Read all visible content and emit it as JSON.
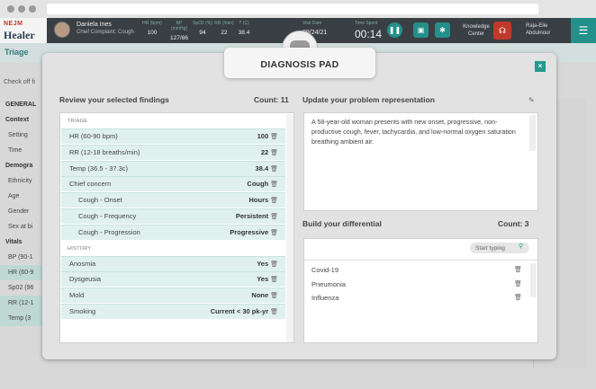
{
  "app": {
    "logo_top": "NEJM",
    "logo_bottom": "Healer",
    "patient_name": "Daniela Ines",
    "chief_complaint": "Chief Complaint: Cough",
    "vitals": [
      {
        "label": "HR (bpm)",
        "value": "100"
      },
      {
        "label": "BP (mmHg)",
        "value": "127/86"
      },
      {
        "label": "SpO2 (%)",
        "value": "94"
      },
      {
        "label": "RR (/min)",
        "value": "22"
      },
      {
        "label": "T (C)",
        "value": "38.4"
      }
    ],
    "visit_label": "Visit Date",
    "visit_date": "09/24/21",
    "time_label": "Time Spent",
    "time_value": "00:14",
    "knowledge_center": "Knowledge Center",
    "user_name": "Raja-Elie Abdulnour"
  },
  "background": {
    "triage_title": "Triage",
    "check_off": "Check off fi",
    "list": [
      {
        "text": "GENERAL",
        "kind": "h"
      },
      {
        "text": "Context",
        "kind": "h"
      },
      {
        "text": "Setting",
        "kind": "i"
      },
      {
        "text": "Time",
        "kind": "i"
      },
      {
        "text": "Demogra",
        "kind": "h"
      },
      {
        "text": "Ethnicity",
        "kind": "i"
      },
      {
        "text": "Age",
        "kind": "i"
      },
      {
        "text": "Gender",
        "kind": "i"
      },
      {
        "text": "Sex at bi",
        "kind": "i"
      },
      {
        "text": "Vitals",
        "kind": "h"
      },
      {
        "text": "BP (90-1",
        "kind": "i"
      },
      {
        "text": "HR (60-9",
        "kind": "t"
      },
      {
        "text": "Sp02 (96",
        "kind": "i"
      },
      {
        "text": "RR (12-1",
        "kind": "t"
      },
      {
        "text": "Temp (3",
        "kind": "t"
      }
    ]
  },
  "modal": {
    "title": "DIAGNOSIS PAD",
    "close_label": "×",
    "findings": {
      "heading": "Review your selected findings",
      "count_label": "Count:",
      "count": "11",
      "triage_header": "TRIAGE",
      "triage": [
        {
          "label": "HR (60-90 bpm)",
          "value": "100",
          "sub": false
        },
        {
          "label": "RR (12-18 breaths/min)",
          "value": "22",
          "sub": false
        },
        {
          "label": "Temp (36.5 - 37.3c)",
          "value": "38.4",
          "sub": false
        },
        {
          "label": "Chief concern",
          "value": "Cough",
          "sub": false
        },
        {
          "label": "Cough - Onset",
          "value": "Hours",
          "sub": true
        },
        {
          "label": "Cough - Frequency",
          "value": "Persistent",
          "sub": true
        },
        {
          "label": "Cough - Progression",
          "value": "Progressive",
          "sub": true
        }
      ],
      "history_header": "HISTORY",
      "history": [
        {
          "label": "Anosmia",
          "value": "Yes",
          "sub": false
        },
        {
          "label": "Dysgeusia",
          "value": "Yes",
          "sub": false
        },
        {
          "label": "Mold",
          "value": "None",
          "sub": false
        },
        {
          "label": "Smoking",
          "value": "Current < 30 pk-yr",
          "sub": false
        }
      ]
    },
    "problem": {
      "heading": "Update your problem representation",
      "text": "A 58-year-old woman presents with new onset, progressive, non-productive cough, fever, tachycardia, and low-normal oxygen saturation breathing ambient air."
    },
    "differential": {
      "heading": "Build your differential",
      "count_label": "Count:",
      "count": "3",
      "search_placeholder": "Start typing",
      "items": [
        "Covid-19",
        "Pneumonia",
        "Influenza"
      ]
    }
  },
  "colors": {
    "accent": "#25998f",
    "header": "#3a3f44",
    "finding_row": "#dff0ee"
  },
  "icons": {
    "trash": "trash-icon",
    "edit": "pencil-icon",
    "search": "search-icon",
    "close": "close-icon",
    "pause": "pause-icon",
    "save": "save-icon",
    "settings": "gear-icon",
    "stethoscope": "stethoscope-icon",
    "menu": "hamburger-icon"
  }
}
